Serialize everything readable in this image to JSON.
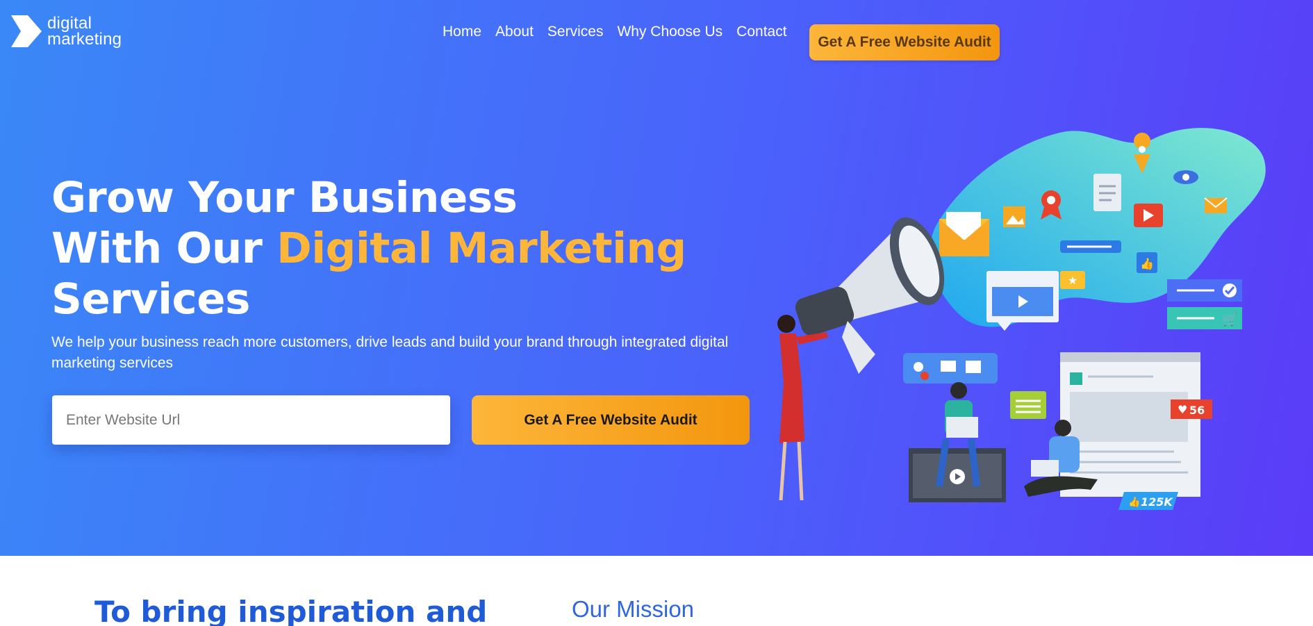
{
  "brand": {
    "line1": "digital",
    "line2": "marketing",
    "logo_icon": "chevron-arrow-icon"
  },
  "nav": {
    "items": [
      {
        "label": "Home"
      },
      {
        "label": "About"
      },
      {
        "label": "Services"
      },
      {
        "label": "Why Choose Us"
      },
      {
        "label": "Contact"
      }
    ],
    "cta_label": "Get A Free Website Audit"
  },
  "hero": {
    "headline_line1": "Grow Your Business",
    "headline_line2_prefix": "With Our ",
    "headline_line2_highlight": "Digital Marketing",
    "headline_line3": "Services",
    "subtext": "We help your business reach more customers, drive leads and build your brand through integrated digital marketing services",
    "input_placeholder": "Enter Website Url",
    "button_label": "Get A Free Website Audit",
    "illustration": {
      "likes_badge": "56",
      "followers_badge": "125K"
    }
  },
  "mission": {
    "heading": "To bring inspiration and",
    "label": "Our Mission"
  },
  "colors": {
    "gradient_start": "#3a88f7",
    "gradient_end": "#5b3cf8",
    "accent_orange": "#fdb63a",
    "heading_blue": "#1f5bd6"
  }
}
